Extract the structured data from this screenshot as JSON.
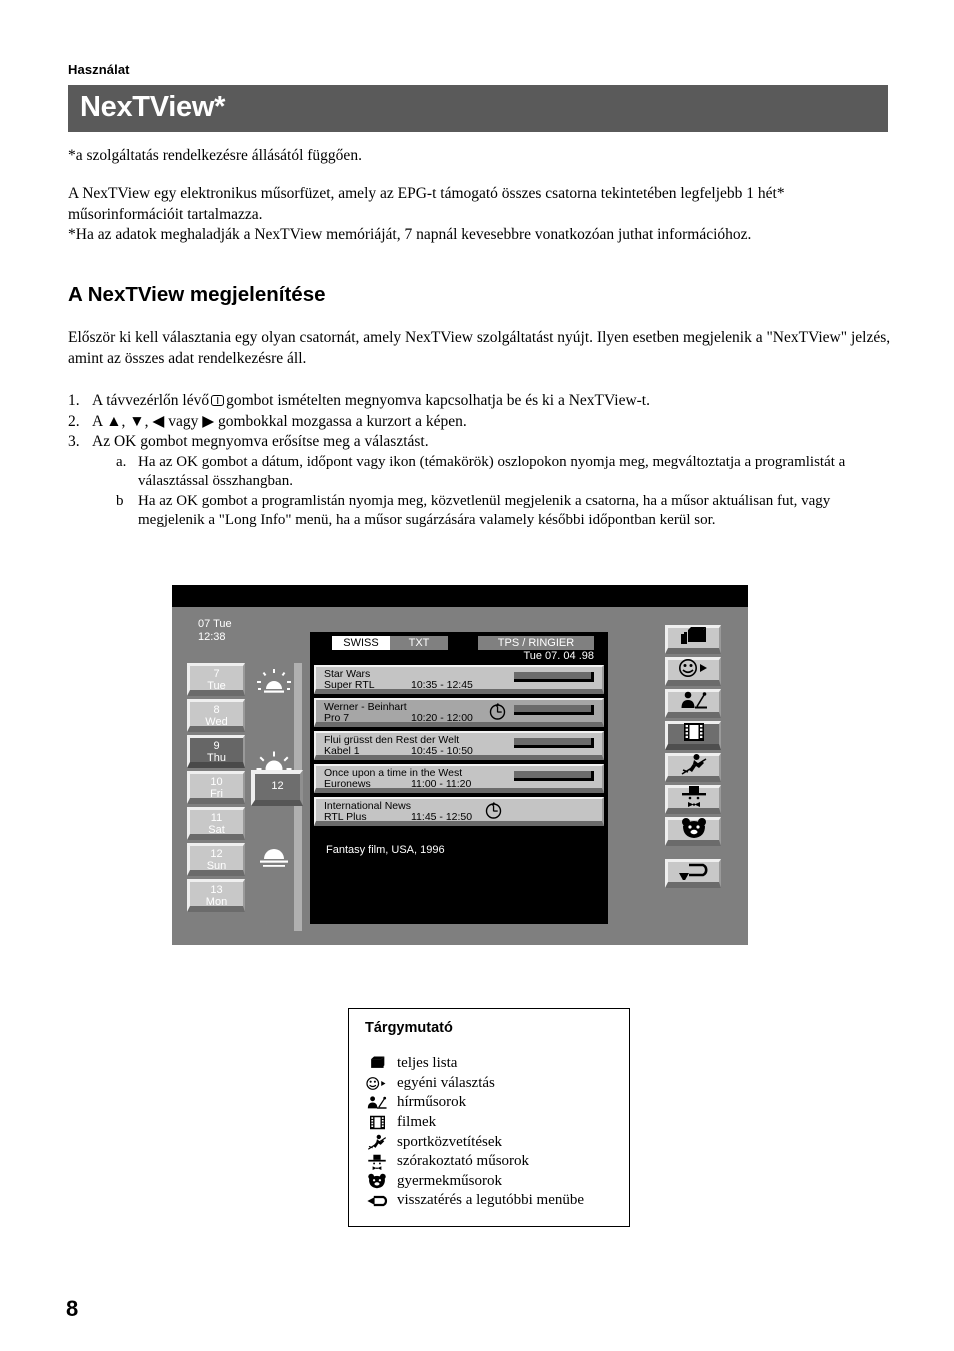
{
  "document": {
    "running_head": "Használat",
    "title": "NexTView*",
    "footnote": "*a szolgáltatás rendelkezésre állásától függően.",
    "intro_paragraph": "A NexTView egy elektronikus műsorfüzet, amely az EPG-t támogató összes csatorna tekintetében legfeljebb 1 hét* műsorinformációit tartalmazza.",
    "intro_note": "*Ha az adatok meghaladják a NexTView memóriáját, 7 napnál kevesebbre vonatkozóan juthat információhoz.",
    "section_heading": "A NexTView megjelenítése",
    "lead_paragraph": "Először ki kell választania egy olyan csatornát, amely NexTView szolgáltatást nyújt.  Ilyen esetben megjelenik a \"NexTView\" jelzés, amint az összes adat rendelkezésre áll.",
    "page_number": "8"
  },
  "steps": [
    {
      "num": "1.",
      "text_before": "A távvezérlőn lévő",
      "icon": "remote-nextview-button-icon",
      "text_after": "gombot ismételten megnyomva kapcsolhatja be és ki a NexTView-t."
    },
    {
      "num": "2.",
      "text": "A ▲, ▼, ◀ vagy ▶ gombokkal mozgassa a kurzort a képen."
    },
    {
      "num": "3.",
      "text": "Az OK gombot megnyomva erősítse meg a választást.",
      "substeps": [
        {
          "letter": "a.",
          "text": "Ha az OK gombot a dátum, időpont vagy ikon (témakörök) oszlopokon nyomja meg, megváltoztatja a programlistát a választással összhangban."
        },
        {
          "letter": "b",
          "text": "Ha az OK gombot a programlistán nyomja meg, közvetlenül megjelenik a csatorna, ha a műsor aktuálisan fut, vagy megjelenik a \"Long Info\" menü, ha a műsor sugárzására valamely későbbi időpontban kerül sor."
        }
      ]
    }
  ],
  "tv_screen": {
    "clock": "07 Tue\n12:38",
    "days": [
      {
        "day": "7",
        "name": "Tue",
        "selected": false
      },
      {
        "day": "8",
        "name": "Wed",
        "selected": false
      },
      {
        "day": "9",
        "name": "Thu",
        "selected": true
      },
      {
        "day": "10",
        "name": "Fri",
        "selected": false
      },
      {
        "day": "11",
        "name": "Sat",
        "selected": false
      },
      {
        "day": "12",
        "name": "Sun",
        "selected": false
      },
      {
        "day": "13",
        "name": "Mon",
        "selected": false
      }
    ],
    "daylight_icons": [
      "sunrise-icon",
      "sun-icon",
      "sunset-icon",
      "moon-icon"
    ],
    "time_slider_value": "12",
    "tags": {
      "channel": "SWISS",
      "teletext": "TXT",
      "provider": "TPS / RINGIER",
      "date": "Tue 07. 04 .98"
    },
    "programs": [
      {
        "title": "Star Wars",
        "channel": "Super RTL",
        "time": "10:35 - 12:45",
        "clock": false,
        "bar": true,
        "highlighted": false
      },
      {
        "title": "Werner - Beinhart",
        "channel": "Pro 7",
        "time": "10:20 - 12:00",
        "clock": true,
        "bar": true,
        "highlighted": true
      },
      {
        "title": "Flui grüsst den Rest der Welt",
        "channel": "Kabel 1",
        "time": "10:45 - 10:50",
        "clock": false,
        "bar": true,
        "highlighted": false
      },
      {
        "title": "Once upon a time in the West",
        "channel": "Euronews",
        "time": "11:00 - 11:20",
        "clock": false,
        "bar": true,
        "highlighted": false
      },
      {
        "title": "International News",
        "channel": "RTL Plus",
        "time": "11:45 - 12:50",
        "clock": true,
        "bar": false,
        "highlighted": false
      }
    ],
    "description": "Fantasy film, USA, 1996",
    "rail_icons": [
      {
        "name": "full-list-icon",
        "selected": false
      },
      {
        "name": "personal-choice-icon",
        "selected": false
      },
      {
        "name": "news-icon",
        "selected": false
      },
      {
        "name": "movies-icon",
        "selected": true
      },
      {
        "name": "sports-icon",
        "selected": false
      },
      {
        "name": "entertainment-icon",
        "selected": false
      },
      {
        "name": "children-icon",
        "selected": false
      },
      {
        "name": "return-icon",
        "selected": false
      }
    ]
  },
  "legend": {
    "title": "Tárgymutató",
    "items": [
      {
        "icon": "full-list-icon",
        "label": "teljes lista"
      },
      {
        "icon": "personal-choice-icon",
        "label": "egyéni választás"
      },
      {
        "icon": "news-icon",
        "label": "hírműsorok"
      },
      {
        "icon": "movies-icon",
        "label": "filmek"
      },
      {
        "icon": "sports-icon",
        "label": "sportközvetítések"
      },
      {
        "icon": "entertainment-icon",
        "label": "szórakoztató műsorok"
      },
      {
        "icon": "children-icon",
        "label": "gyermekműsorok"
      },
      {
        "icon": "return-icon",
        "label": "visszatérés a legutóbbi menübe"
      }
    ]
  },
  "colors": {
    "title_bar": "#5a5a5a",
    "tv_background": "#7f7f7f",
    "button_face": "#c8c8c8",
    "button_selected": "#666666",
    "panel_black": "#000000"
  }
}
